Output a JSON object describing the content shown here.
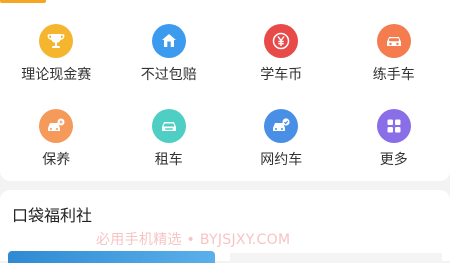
{
  "grid": {
    "items": [
      {
        "label": "理论现金赛",
        "icon": "trophy-icon",
        "color": "#f5b52e"
      },
      {
        "label": "不过包赔",
        "icon": "home-shield-icon",
        "color": "#3d9bef"
      },
      {
        "label": "学车币",
        "icon": "yen-coin-icon",
        "color": "#e84a4a"
      },
      {
        "label": "练手车",
        "icon": "car-icon",
        "color": "#f47c4e"
      },
      {
        "label": "保养",
        "icon": "car-wrench-icon",
        "color": "#f59a5b"
      },
      {
        "label": "租车",
        "icon": "car-rental-icon",
        "color": "#4fcfc4"
      },
      {
        "label": "网约车",
        "icon": "ride-hailing-icon",
        "color": "#4a8fe6"
      },
      {
        "label": "更多",
        "icon": "more-grid-icon",
        "color": "#8a6ee8"
      }
    ]
  },
  "section": {
    "title": "口袋福利社"
  },
  "watermark": "必用手机精选 • BYJSJXY.COM",
  "colors": {
    "tab_indicator": "#f5a623",
    "background": "#f3f3f3"
  }
}
